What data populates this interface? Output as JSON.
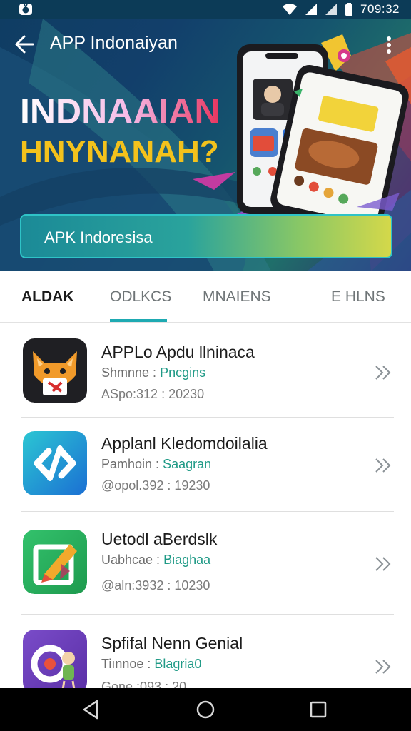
{
  "status_bar": {
    "time": "709:32"
  },
  "app_bar": {
    "title": "APP Indonaiyan"
  },
  "hero": {
    "headline": "INDNAAIAN",
    "subheadline": "HNYNANAH?",
    "search_value": "APK Indoresisa"
  },
  "tabs": [
    {
      "label": "ALDAK"
    },
    {
      "label": "ODLKCS"
    },
    {
      "label": "MNAIENS"
    },
    {
      "label": "E HLNS"
    }
  ],
  "apps": [
    {
      "name": "APPLo Apdu llninaca",
      "meta_label": "Shmnne :",
      "category": "Pncgins",
      "info": "ASpo:312 : 20230",
      "icon": "fox-icon"
    },
    {
      "name": "Applanl Kledomdoilalia",
      "meta_label": "Pamhoin :",
      "category": "Saagran",
      "info": "@opol.392 : 19230",
      "icon": "link-icon"
    },
    {
      "name": "Uetodl aBerdslk",
      "meta_label": "Uabhcae :",
      "category": "Biaghaa",
      "info": "@aln:3932 : 10230",
      "icon": "edit-icon"
    },
    {
      "name": "Spfifal Nenn Genial",
      "meta_label": "Tiınnoe :",
      "category": "Blagria0",
      "info": "Gone :093 : 20",
      "icon": "character-icon"
    }
  ],
  "colors": {
    "accent": "#1eaab2",
    "category": "#1f9a86",
    "headline_yellow": "#f3c21c"
  }
}
